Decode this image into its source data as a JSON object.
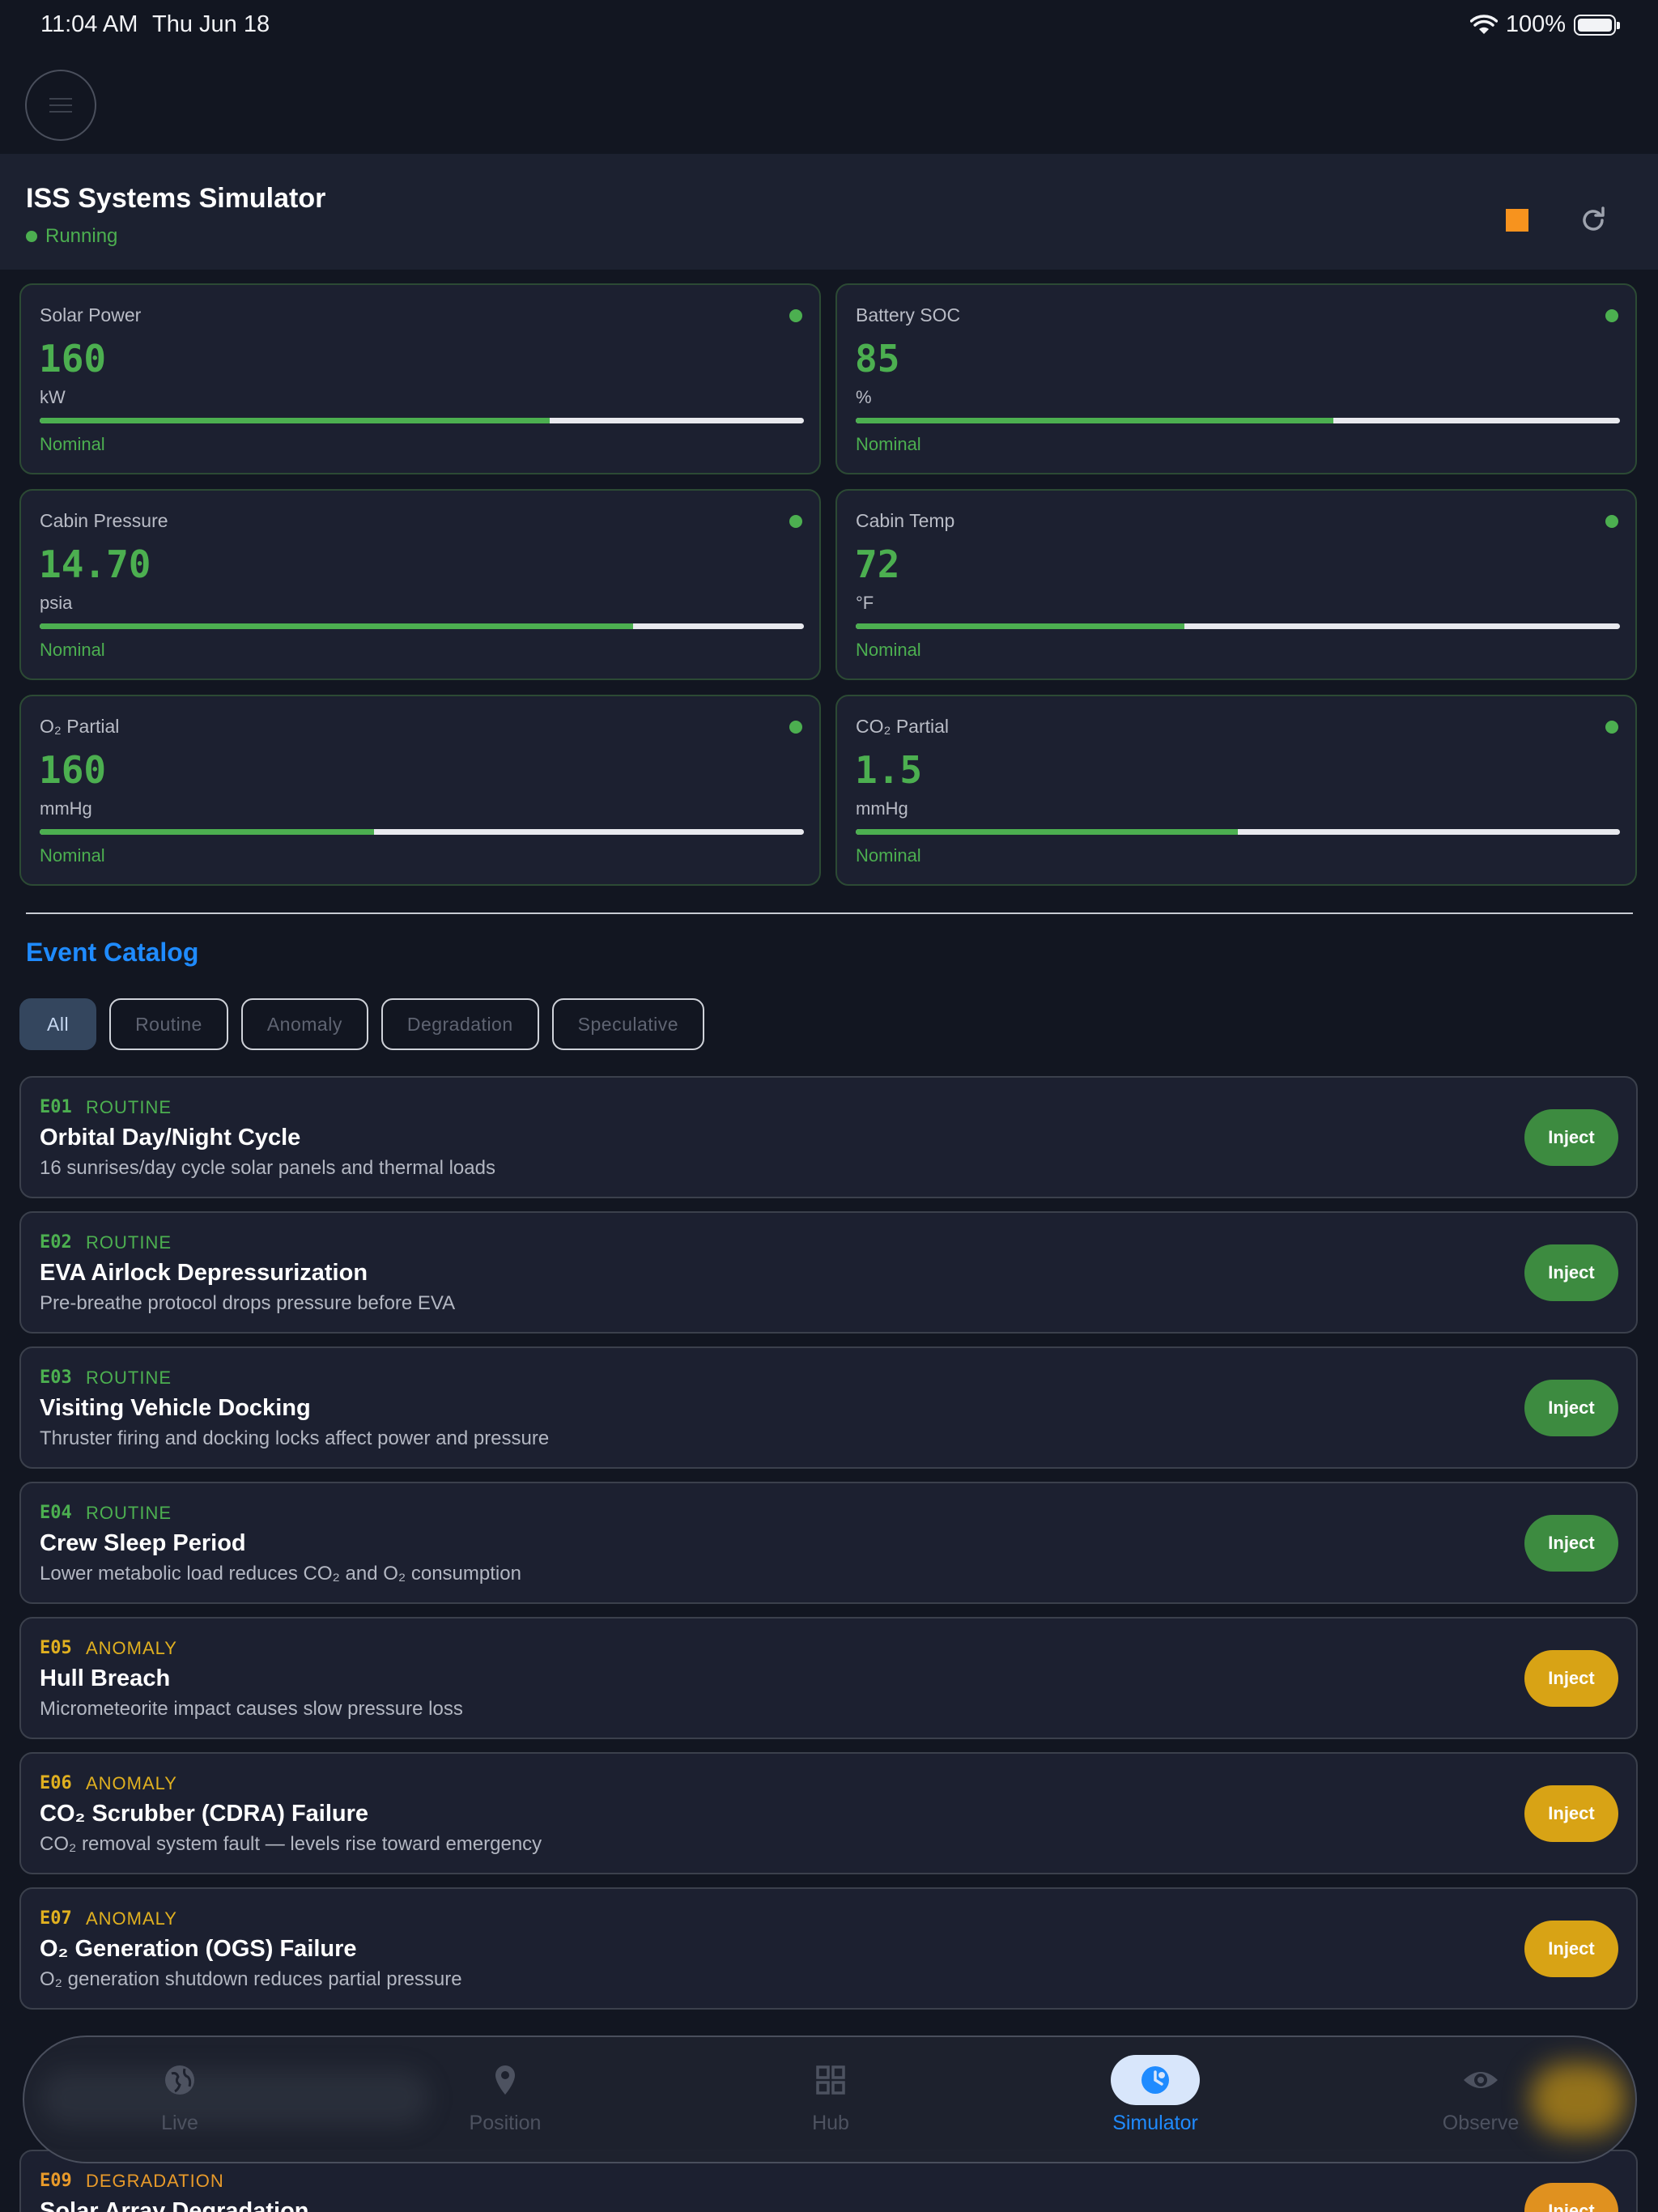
{
  "status_bar": {
    "time": "11:04 AM",
    "date": "Thu Jun 18",
    "battery": "100%"
  },
  "header": {
    "title": "ISS Systems Simulator",
    "status": "Running"
  },
  "metrics": [
    {
      "label": "Solar Power",
      "value": "160",
      "unit": "kW",
      "status": "Nominal",
      "level": 0.667
    },
    {
      "label": "Battery SOC",
      "value": "85",
      "unit": "%",
      "status": "Nominal",
      "level": 0.625
    },
    {
      "label": "Cabin Pressure",
      "value": "14.70",
      "unit": "psia",
      "status": "Nominal",
      "level": 0.777
    },
    {
      "label": "Cabin Temp",
      "value": "72",
      "unit": "°F",
      "status": "Nominal",
      "level": 0.43
    },
    {
      "label": "O₂ Partial",
      "value": "160",
      "unit": "mmHg",
      "status": "Nominal",
      "level": 0.437
    },
    {
      "label": "CO₂ Partial",
      "value": "1.5",
      "unit": "mmHg",
      "status": "Nominal",
      "level": 0.5
    }
  ],
  "catalog": {
    "title": "Event Catalog",
    "filters": [
      "All",
      "Routine",
      "Anomaly",
      "Degradation",
      "Speculative"
    ],
    "active_filter": "All",
    "inject_label": "Inject",
    "events": [
      {
        "code": "E01",
        "category": "ROUTINE",
        "title": "Orbital Day/Night Cycle",
        "description": "16 sunrises/day cycle solar panels and thermal loads"
      },
      {
        "code": "E02",
        "category": "ROUTINE",
        "title": "EVA Airlock Depressurization",
        "description": "Pre-breathe protocol drops pressure before EVA"
      },
      {
        "code": "E03",
        "category": "ROUTINE",
        "title": "Visiting Vehicle Docking",
        "description": "Thruster firing and docking locks affect power and pressure"
      },
      {
        "code": "E04",
        "category": "ROUTINE",
        "title": "Crew Sleep Period",
        "description": "Lower metabolic load reduces CO₂ and O₂ consumption"
      },
      {
        "code": "E05",
        "category": "ANOMALY",
        "title": "Hull Breach",
        "description": "Micrometeorite impact causes slow pressure loss"
      },
      {
        "code": "E06",
        "category": "ANOMALY",
        "title": "CO₂ Scrubber (CDRA) Failure",
        "description": "CO₂ removal system fault — levels rise toward emergency"
      },
      {
        "code": "E07",
        "category": "ANOMALY",
        "title": "O₂ Generation (OGS) Failure",
        "description": "O₂ generation shutdown reduces partial pressure"
      },
      {
        "code": "E09",
        "category": "DEGRADATION",
        "title": "Solar Array Degradation",
        "description": ""
      }
    ]
  },
  "tabs": [
    {
      "label": "Live",
      "icon": "globe-icon"
    },
    {
      "label": "Position",
      "icon": "location-pin-icon"
    },
    {
      "label": "Hub",
      "icon": "grid-icon"
    },
    {
      "label": "Simulator",
      "icon": "simulator-icon"
    },
    {
      "label": "Observe",
      "icon": "eye-icon"
    }
  ],
  "active_tab": "Simulator",
  "colors": {
    "accent": "#1f8bff",
    "nominal": "#4caf50",
    "anomaly": "#e0b020",
    "degradation": "#e89a2a",
    "stop": "#f7931e"
  }
}
